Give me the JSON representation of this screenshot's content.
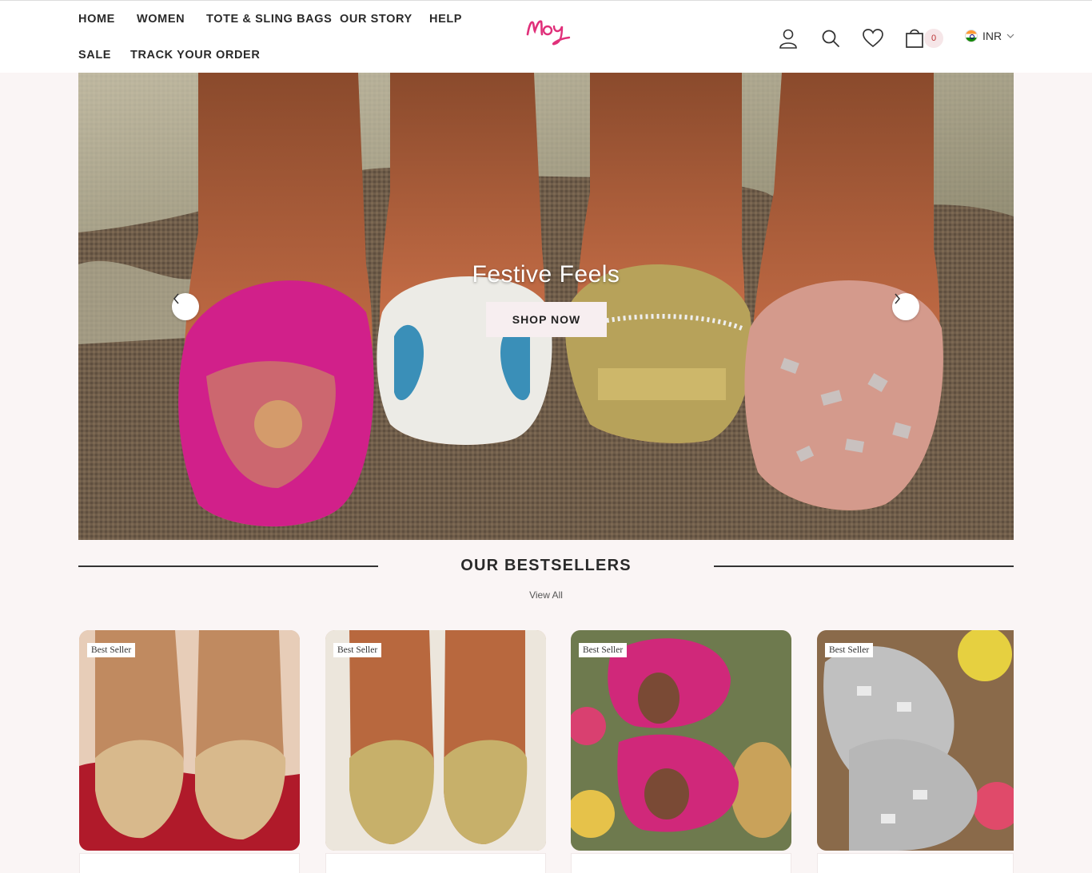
{
  "nav": {
    "items": [
      "HOME",
      "WOMEN",
      "TOTE & SLING BAGS",
      "OUR STORY",
      "HELP",
      "SALE",
      "TRACK YOUR ORDER"
    ]
  },
  "logo": {
    "text": "Moy"
  },
  "header": {
    "cart_count": "0",
    "currency": "INR",
    "icons": [
      "user-icon",
      "search-icon",
      "heart-icon",
      "cart-icon",
      "india-flag-icon",
      "chevron-down-icon"
    ]
  },
  "hero": {
    "title": "Festive Feels",
    "cta": "SHOP NOW"
  },
  "bestsellers": {
    "title": "OUR BESTSELLERS",
    "view_all": "View All",
    "products": [
      {
        "badge": "Best Seller"
      },
      {
        "badge": "Best Seller"
      },
      {
        "badge": "Best Seller"
      },
      {
        "badge": "Best Seller"
      }
    ]
  },
  "colors": {
    "accent_pink": "#e0307a",
    "page_bg": "#faf5f5",
    "button_bg": "#f7eef0"
  }
}
